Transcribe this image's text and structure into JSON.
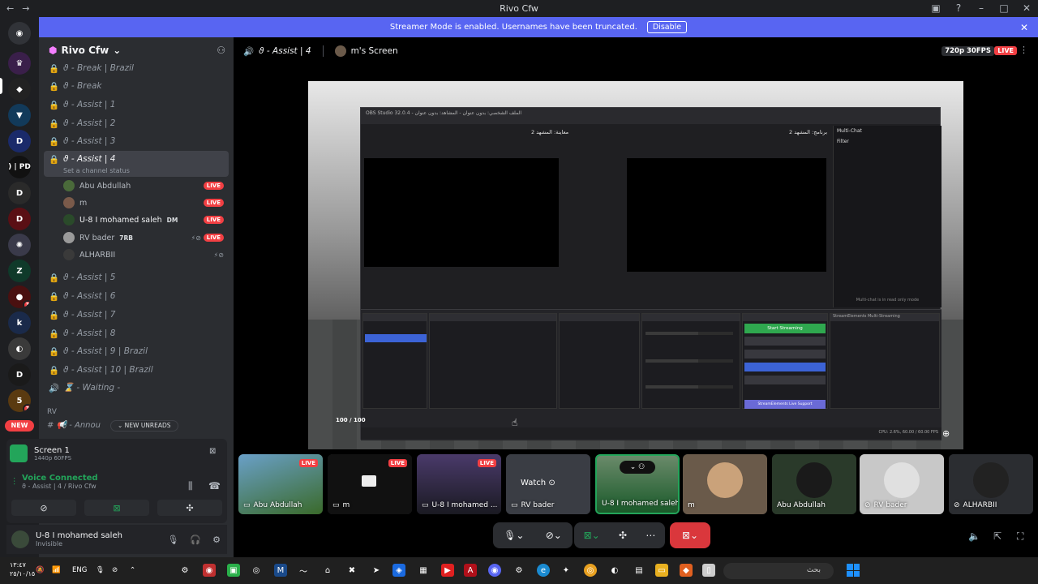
{
  "window": {
    "title": "Rivo Cfw"
  },
  "banner": {
    "text": "Streamer Mode is enabled. Usernames have been truncated.",
    "button": "Disable"
  },
  "server": {
    "name": "Rivo Cfw"
  },
  "channels": [
    {
      "name": "ϑ - Break | Brazil"
    },
    {
      "name": "ϑ - Break"
    },
    {
      "name": "ϑ - Assist | 1"
    },
    {
      "name": "ϑ - Assist | 2"
    },
    {
      "name": "ϑ - Assist | 3"
    },
    {
      "name": "ϑ - Assist | 4",
      "status": "Set a channel status"
    },
    {
      "name": "ϑ - Assist | 5"
    },
    {
      "name": "ϑ - Assist | 6"
    },
    {
      "name": "ϑ - Assist | 7"
    },
    {
      "name": "ϑ - Assist | 8"
    },
    {
      "name": "ϑ - Assist | 9 | Brazil"
    },
    {
      "name": "ϑ - Assist | 10 | Brazil"
    },
    {
      "name": "⌛ - Waiting -"
    }
  ],
  "voice_users": [
    {
      "name": "Abu Abdullah",
      "live": "LIVE"
    },
    {
      "name": "m",
      "live": "LIVE"
    },
    {
      "name": "U-8 I mohamed saleh",
      "tag": "DM",
      "live": "LIVE"
    },
    {
      "name": "RV bader",
      "tag": "7RB",
      "live": "LIVE"
    },
    {
      "name": "ALHARBII"
    }
  ],
  "category": "RV",
  "announce_channel": "Annou",
  "new_unreads": "NEW UNREADS",
  "rail": {
    "new_label": "NEW",
    "pd_label": ") | PD",
    "badges": [
      "3",
      "3"
    ]
  },
  "screen_panel": {
    "title": "Screen 1",
    "sub": "1440p 60FPS"
  },
  "voice_panel": {
    "status": "Voice Connected",
    "channel": "ϑ - Assist | 4 / Rivo Cfw"
  },
  "user_panel": {
    "name": "U-8 I mohamed saleh",
    "status": "Invisible"
  },
  "stage": {
    "channel": "ϑ - Assist | 4",
    "stream_owner": "m's Screen",
    "quality": "720p 30FPS",
    "live": "LIVE"
  },
  "obs": {
    "menu": "OBS Studio 32.0.4 - الملف الشخصي: بدون عنوان - المشاهد: بدون عنوان",
    "scene_left": "معاينة: المشهد 2",
    "scene_right": "برنامج: المشهد 2",
    "chat_title": "Multi-Chat",
    "chat_filter": "Filter",
    "chat_ro": "Multi-chat is in read only mode",
    "start_streaming": "Start Streaming",
    "se_title": "StreamElements Multi-Streaming",
    "se_support": "StreamElements Live Support",
    "status": "CPU: 2.6%, 60.00 / 60.00 FPS",
    "hud": "100 / 100"
  },
  "tiles": [
    {
      "name": "Abu Abdullah",
      "live": "LIVE"
    },
    {
      "name": "m",
      "live": "LIVE"
    },
    {
      "name": "U-8 I mohamed ...",
      "live": "LIVE"
    },
    {
      "name": "RV bader",
      "watch": "Watch"
    },
    {
      "name": "U-8 I mohamed saleh"
    },
    {
      "name": "m"
    },
    {
      "name": "Abu Abdullah"
    },
    {
      "name": "RV bader"
    },
    {
      "name": "ALHARBII"
    }
  ],
  "taskbar": {
    "time": "١٣:٤٧",
    "date": "٢٥/١٠/١٥",
    "lang": "ENG",
    "search_placeholder": "بحث"
  },
  "colors": {
    "accent": "#5865f2",
    "live": "#f23f43",
    "connected": "#23a55a"
  }
}
